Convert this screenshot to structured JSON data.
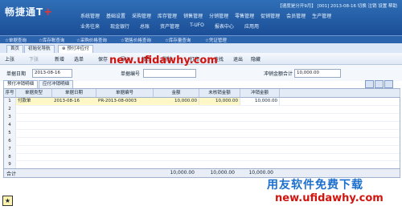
{
  "app": {
    "logo_text": "畅捷通T",
    "logo_plus": "+",
    "status_line": "【速度是分开9月】 [001] 2013-08-16  切换  注销  设置  帮助"
  },
  "menu": {
    "row1": [
      "系统管理",
      "基础设置",
      "采购管理",
      "库存管理",
      "销售管理",
      "分销管理",
      "零售管理",
      "促销管理",
      "会员管理",
      "生产管理"
    ],
    "row2": [
      "业务往来",
      "现金银行",
      "总账",
      "资产管理",
      "T-UFO",
      "报表中心",
      "应用用"
    ]
  },
  "subbar": [
    "☆单据查询",
    "☆库存账查询",
    "☆采购价格查询",
    "☆销售价格查询",
    "☆库存量查询",
    "☆凭证管理"
  ],
  "page_tabs": [
    "首页",
    "初始化导航",
    "预付冲应付"
  ],
  "toolbar": [
    "上张",
    "下张",
    "新增",
    "选单",
    "保存",
    "导入",
    "修改",
    "删除",
    "打印",
    "查找",
    "退出",
    "隐藏"
  ],
  "form": {
    "date_label": "单据日期",
    "date_value": "2013-08-16",
    "code_label": "单据编号",
    "amount_label": "冲销金额合计",
    "amount_value": "10,000.00"
  },
  "subtabs": [
    "预付冲销明细",
    "应付冲销明细"
  ],
  "grid": {
    "headers": [
      "序号",
      "单据类型",
      "单据日期",
      "单据编号",
      "金额",
      "未核销金额",
      "冲销金额"
    ],
    "rows": [
      [
        "1",
        "付款单",
        "2013-08-16",
        "PR-2013-08-0003",
        "10,000.00",
        "10,000.00",
        "10,000.00"
      ]
    ],
    "empty_row_numbers": [
      "2",
      "3",
      "4",
      "5",
      "6",
      "7",
      "8",
      "9"
    ],
    "total_label": "合计",
    "total_amount": "10,000.00",
    "total_unverified": "10,000.00",
    "total_writeoff": "10,000.00"
  },
  "watermarks": {
    "top_url": "new.ufidawhy.com",
    "bottom_title": "用友软件免费下载",
    "bottom_url": "new.ufidawhy.com"
  }
}
